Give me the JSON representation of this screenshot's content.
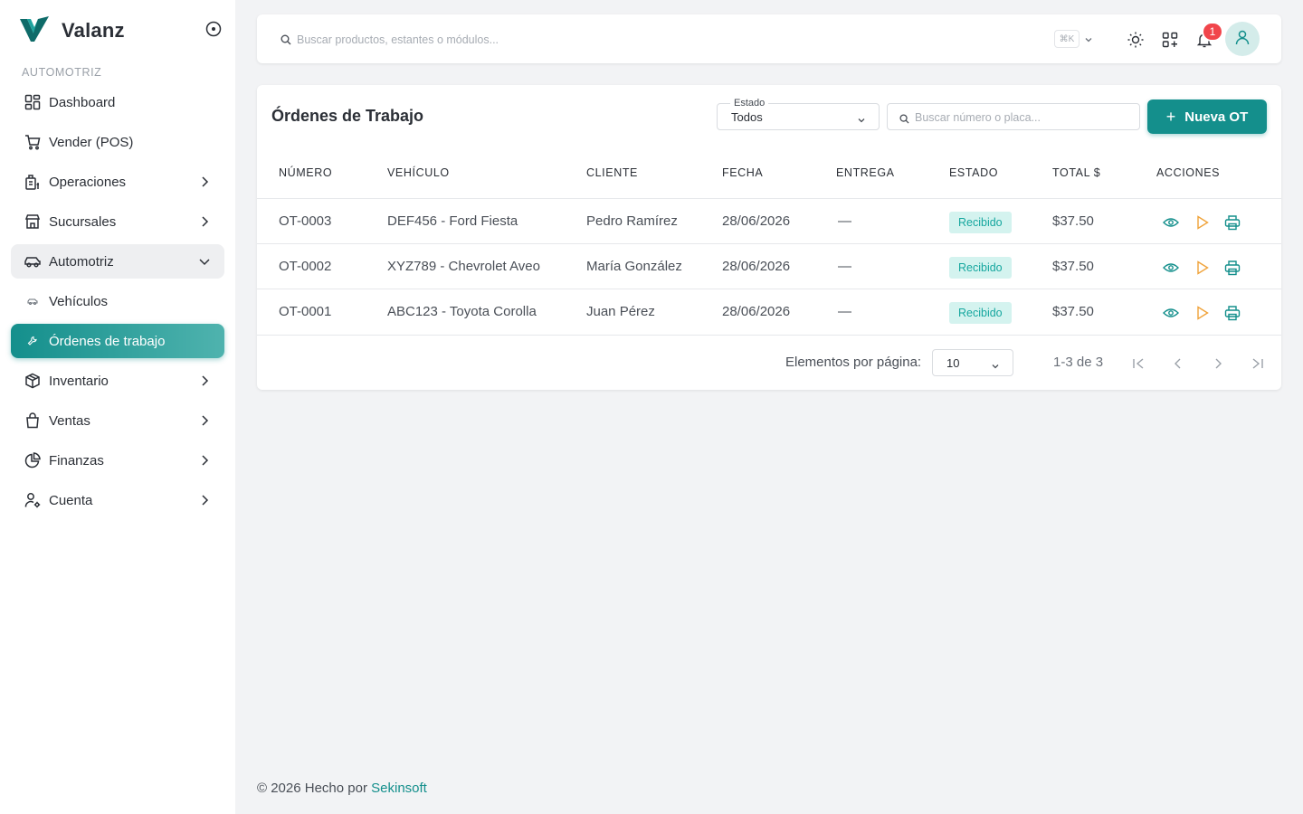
{
  "app": {
    "brand": "Valanz",
    "section_label": "AUTOMOTRIZ"
  },
  "sidebar": {
    "items": [
      {
        "label": "Dashboard",
        "icon": "dashboard-icon"
      },
      {
        "label": "Vender (POS)",
        "icon": "cart-icon"
      },
      {
        "label": "Operaciones",
        "icon": "operations-icon"
      },
      {
        "label": "Sucursales",
        "icon": "store-icon"
      },
      {
        "label": "Automotriz",
        "icon": "car-icon"
      },
      {
        "label": "Vehículos",
        "icon": "vehicle-icon"
      },
      {
        "label": "Órdenes de trabajo",
        "icon": "wrench-icon"
      },
      {
        "label": "Inventario",
        "icon": "box-icon"
      },
      {
        "label": "Ventas",
        "icon": "shopping-bag-icon"
      },
      {
        "label": "Finanzas",
        "icon": "pie-chart-icon"
      },
      {
        "label": "Cuenta",
        "icon": "user-settings-icon"
      }
    ]
  },
  "topbar": {
    "search_placeholder": "Buscar productos, estantes o módulos...",
    "shortcut": "⌘K",
    "notifications_count": "1"
  },
  "page": {
    "title": "Órdenes de Trabajo",
    "filter": {
      "label": "Estado",
      "value": "Todos"
    },
    "search_placeholder": "Buscar número o placa...",
    "new_button": "Nueva OT"
  },
  "table": {
    "columns": [
      "NÚMERO",
      "VEHÍCULO",
      "CLIENTE",
      "FECHA",
      "ENTREGA",
      "ESTADO",
      "TOTAL $",
      "ACCIONES"
    ],
    "rows": [
      {
        "numero": "OT-0003",
        "vehiculo": "DEF456 - Ford Fiesta",
        "cliente": "Pedro Ramírez",
        "fecha": "28/06/2026",
        "entrega": "—",
        "estado": "Recibido",
        "total": "$37.50"
      },
      {
        "numero": "OT-0002",
        "vehiculo": "XYZ789 - Chevrolet Aveo",
        "cliente": "María González",
        "fecha": "28/06/2026",
        "entrega": "—",
        "estado": "Recibido",
        "total": "$37.50"
      },
      {
        "numero": "OT-0001",
        "vehiculo": "ABC123 - Toyota Corolla",
        "cliente": "Juan Pérez",
        "fecha": "28/06/2026",
        "entrega": "—",
        "estado": "Recibido",
        "total": "$37.50"
      }
    ]
  },
  "pagination": {
    "label": "Elementos por página:",
    "page_size": "10",
    "range": "1-3 de 3"
  },
  "footer": {
    "text": "© 2026 Hecho por",
    "link": "Sekinsoft"
  },
  "colors": {
    "accent": "#148f8c",
    "status_bg": "#d4f3ef",
    "status_text": "#16a79f",
    "badge": "#f1454b",
    "warning": "#f0a33a"
  }
}
